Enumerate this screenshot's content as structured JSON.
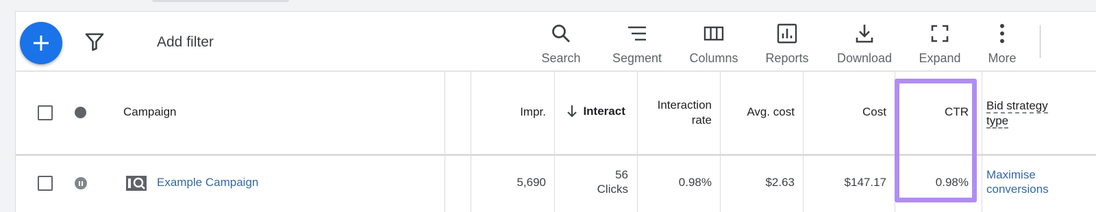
{
  "toolbar": {
    "add_filter": "Add filter",
    "tools": [
      {
        "label": "Search",
        "icon": "search-icon"
      },
      {
        "label": "Segment",
        "icon": "segment-icon"
      },
      {
        "label": "Columns",
        "icon": "columns-icon"
      },
      {
        "label": "Reports",
        "icon": "reports-icon"
      },
      {
        "label": "Download",
        "icon": "download-icon"
      },
      {
        "label": "Expand",
        "icon": "expand-icon"
      },
      {
        "label": "More",
        "icon": "more-vert-icon"
      }
    ]
  },
  "table": {
    "headers": {
      "campaign": "Campaign",
      "impr": "Impr.",
      "interactions": "Interact",
      "interaction_rate_1": "Interaction",
      "interaction_rate_2": "rate",
      "avg_cost": "Avg. cost",
      "cost": "Cost",
      "ctr": "CTR",
      "bid_strategy_1": "Bid strategy",
      "bid_strategy_2": "type"
    },
    "rows": [
      {
        "campaign": "Example Campaign",
        "status": "paused",
        "impr": "5,690",
        "interactions_value": "56",
        "interactions_unit": "Clicks",
        "interaction_rate": "0.98%",
        "avg_cost": "$2.63",
        "cost": "$147.17",
        "ctr": "0.98%",
        "bid_strategy_1": "Maximise",
        "bid_strategy_2": "conversions"
      }
    ]
  },
  "colors": {
    "accent": "#1a73e8",
    "highlight": "#b08df2",
    "link": "#3367a8"
  }
}
